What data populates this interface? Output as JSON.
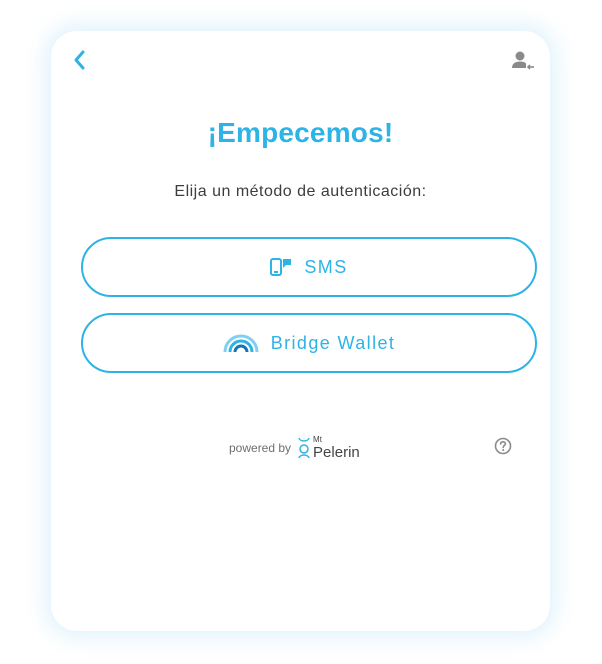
{
  "header": {
    "back_icon": "chevron-left-icon",
    "account_icon": "user-switch-icon"
  },
  "main": {
    "title": "¡Empecemos!",
    "subtitle": "Elija un método de autenticación:",
    "methods": [
      {
        "label": "SMS",
        "icon": "sms-phone-icon"
      },
      {
        "label": "Bridge Wallet",
        "icon": "bridge-wallet-icon"
      }
    ]
  },
  "footer": {
    "powered_by": "powered by",
    "brand_small": "Mt",
    "brand_name": "Pelerin",
    "help_icon": "question-circle-icon"
  },
  "colors": {
    "accent": "#2db3e6",
    "text": "#3d3d3d",
    "muted": "#6f6f6f",
    "icon_gray": "#8a8a8a"
  }
}
